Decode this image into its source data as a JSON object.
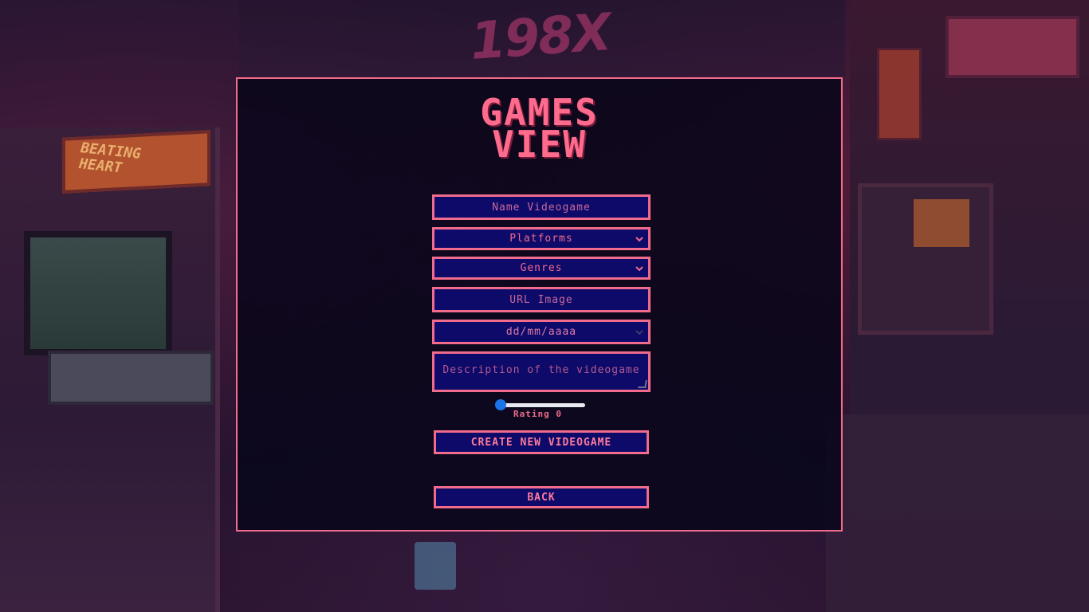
{
  "background": {
    "neon_sign": "198X",
    "arcade_marquee": [
      "BEATING",
      "HEART"
    ]
  },
  "page": {
    "title_line1": "GAMES",
    "title_line2": "VIEW"
  },
  "form": {
    "name_placeholder": "Name Videogame",
    "platforms_selected": "Platforms",
    "genres_selected": "Genres",
    "url_placeholder": "URL Image",
    "date_placeholder": "dd/mm/aaaa",
    "description_placeholder": "Description of the videogame",
    "rating_label": "Rating 0",
    "rating_value": 0,
    "create_button": "CREATE NEW VIDEOGAME",
    "back_button": "BACK"
  },
  "colors": {
    "accent": "#f06b8c",
    "field_bg": "#0d0a6a",
    "card_bg": "#08061a"
  }
}
